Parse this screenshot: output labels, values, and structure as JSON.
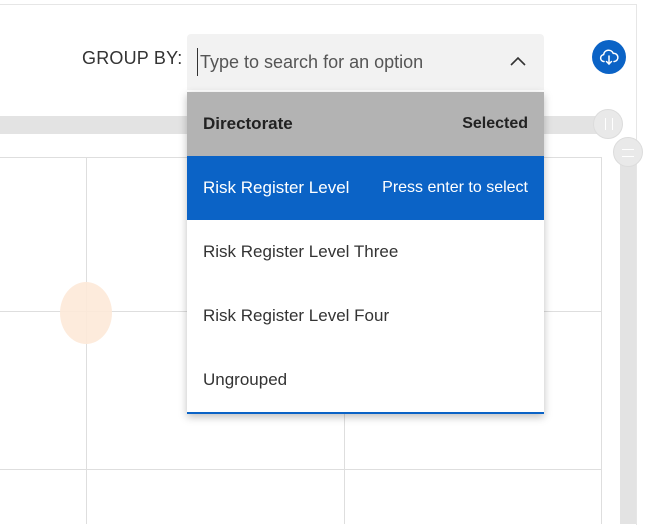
{
  "group_by": {
    "label": "GROUP BY:",
    "placeholder": "Type to search for an option"
  },
  "options": [
    {
      "label": "Directorate",
      "hint": "Selected",
      "state": "selected"
    },
    {
      "label": "Risk Register Level",
      "hint": "Press enter to select",
      "state": "active"
    },
    {
      "label": "Risk Register Level Three",
      "hint": "",
      "state": "normal"
    },
    {
      "label": "Risk Register Level Four",
      "hint": "",
      "state": "normal"
    },
    {
      "label": "Ungrouped",
      "hint": "",
      "state": "normal"
    }
  ],
  "icons": {
    "combo_toggle": "chevron-up-icon",
    "download": "cloud-download-icon"
  },
  "colors": {
    "accent": "#0b63c6",
    "selected_bg": "#b3b3b3",
    "bubble": "#fde9d8"
  }
}
